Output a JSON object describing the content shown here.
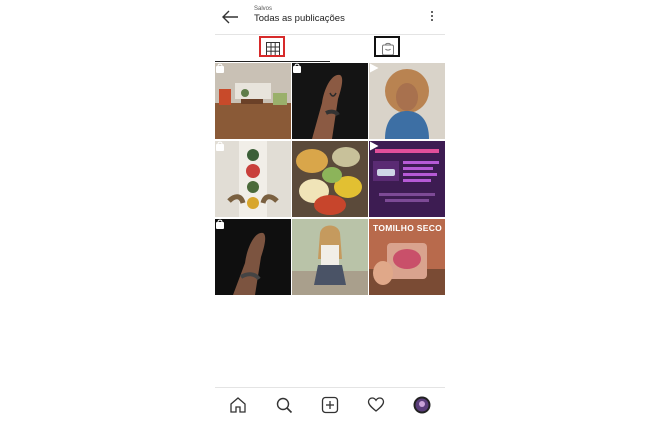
{
  "header": {
    "subtitle": "Salvos",
    "title": "Todas as publicações"
  },
  "tabs": [
    {
      "name": "grid",
      "icon": "grid-icon"
    },
    {
      "name": "shopping",
      "icon": "shopping-bag-icon"
    }
  ],
  "grid": {
    "cells": [
      {
        "type": "shopping",
        "scene": "living-room"
      },
      {
        "type": "shopping",
        "scene": "hand-tattoo"
      },
      {
        "type": "video",
        "scene": "curly-hair-woman"
      },
      {
        "type": "shopping",
        "scene": "decorated-hands"
      },
      {
        "type": "image",
        "scene": "food-platter"
      },
      {
        "type": "video",
        "scene": "purple-infographic"
      },
      {
        "type": "shopping",
        "scene": "hand-bracelet"
      },
      {
        "type": "image",
        "scene": "woman-outdoors"
      },
      {
        "type": "image",
        "scene": "tomilho-seco",
        "caption": "TOMILHO SECO"
      }
    ]
  },
  "bottom_nav": [
    {
      "name": "home",
      "icon": "home-icon"
    },
    {
      "name": "search",
      "icon": "search-icon"
    },
    {
      "name": "new-post",
      "icon": "add-post-icon"
    },
    {
      "name": "activity",
      "icon": "heart-icon"
    },
    {
      "name": "profile",
      "icon": "avatar"
    }
  ],
  "colors": {
    "highlight_red": "#d72a2a",
    "highlight_black": "#111111"
  }
}
